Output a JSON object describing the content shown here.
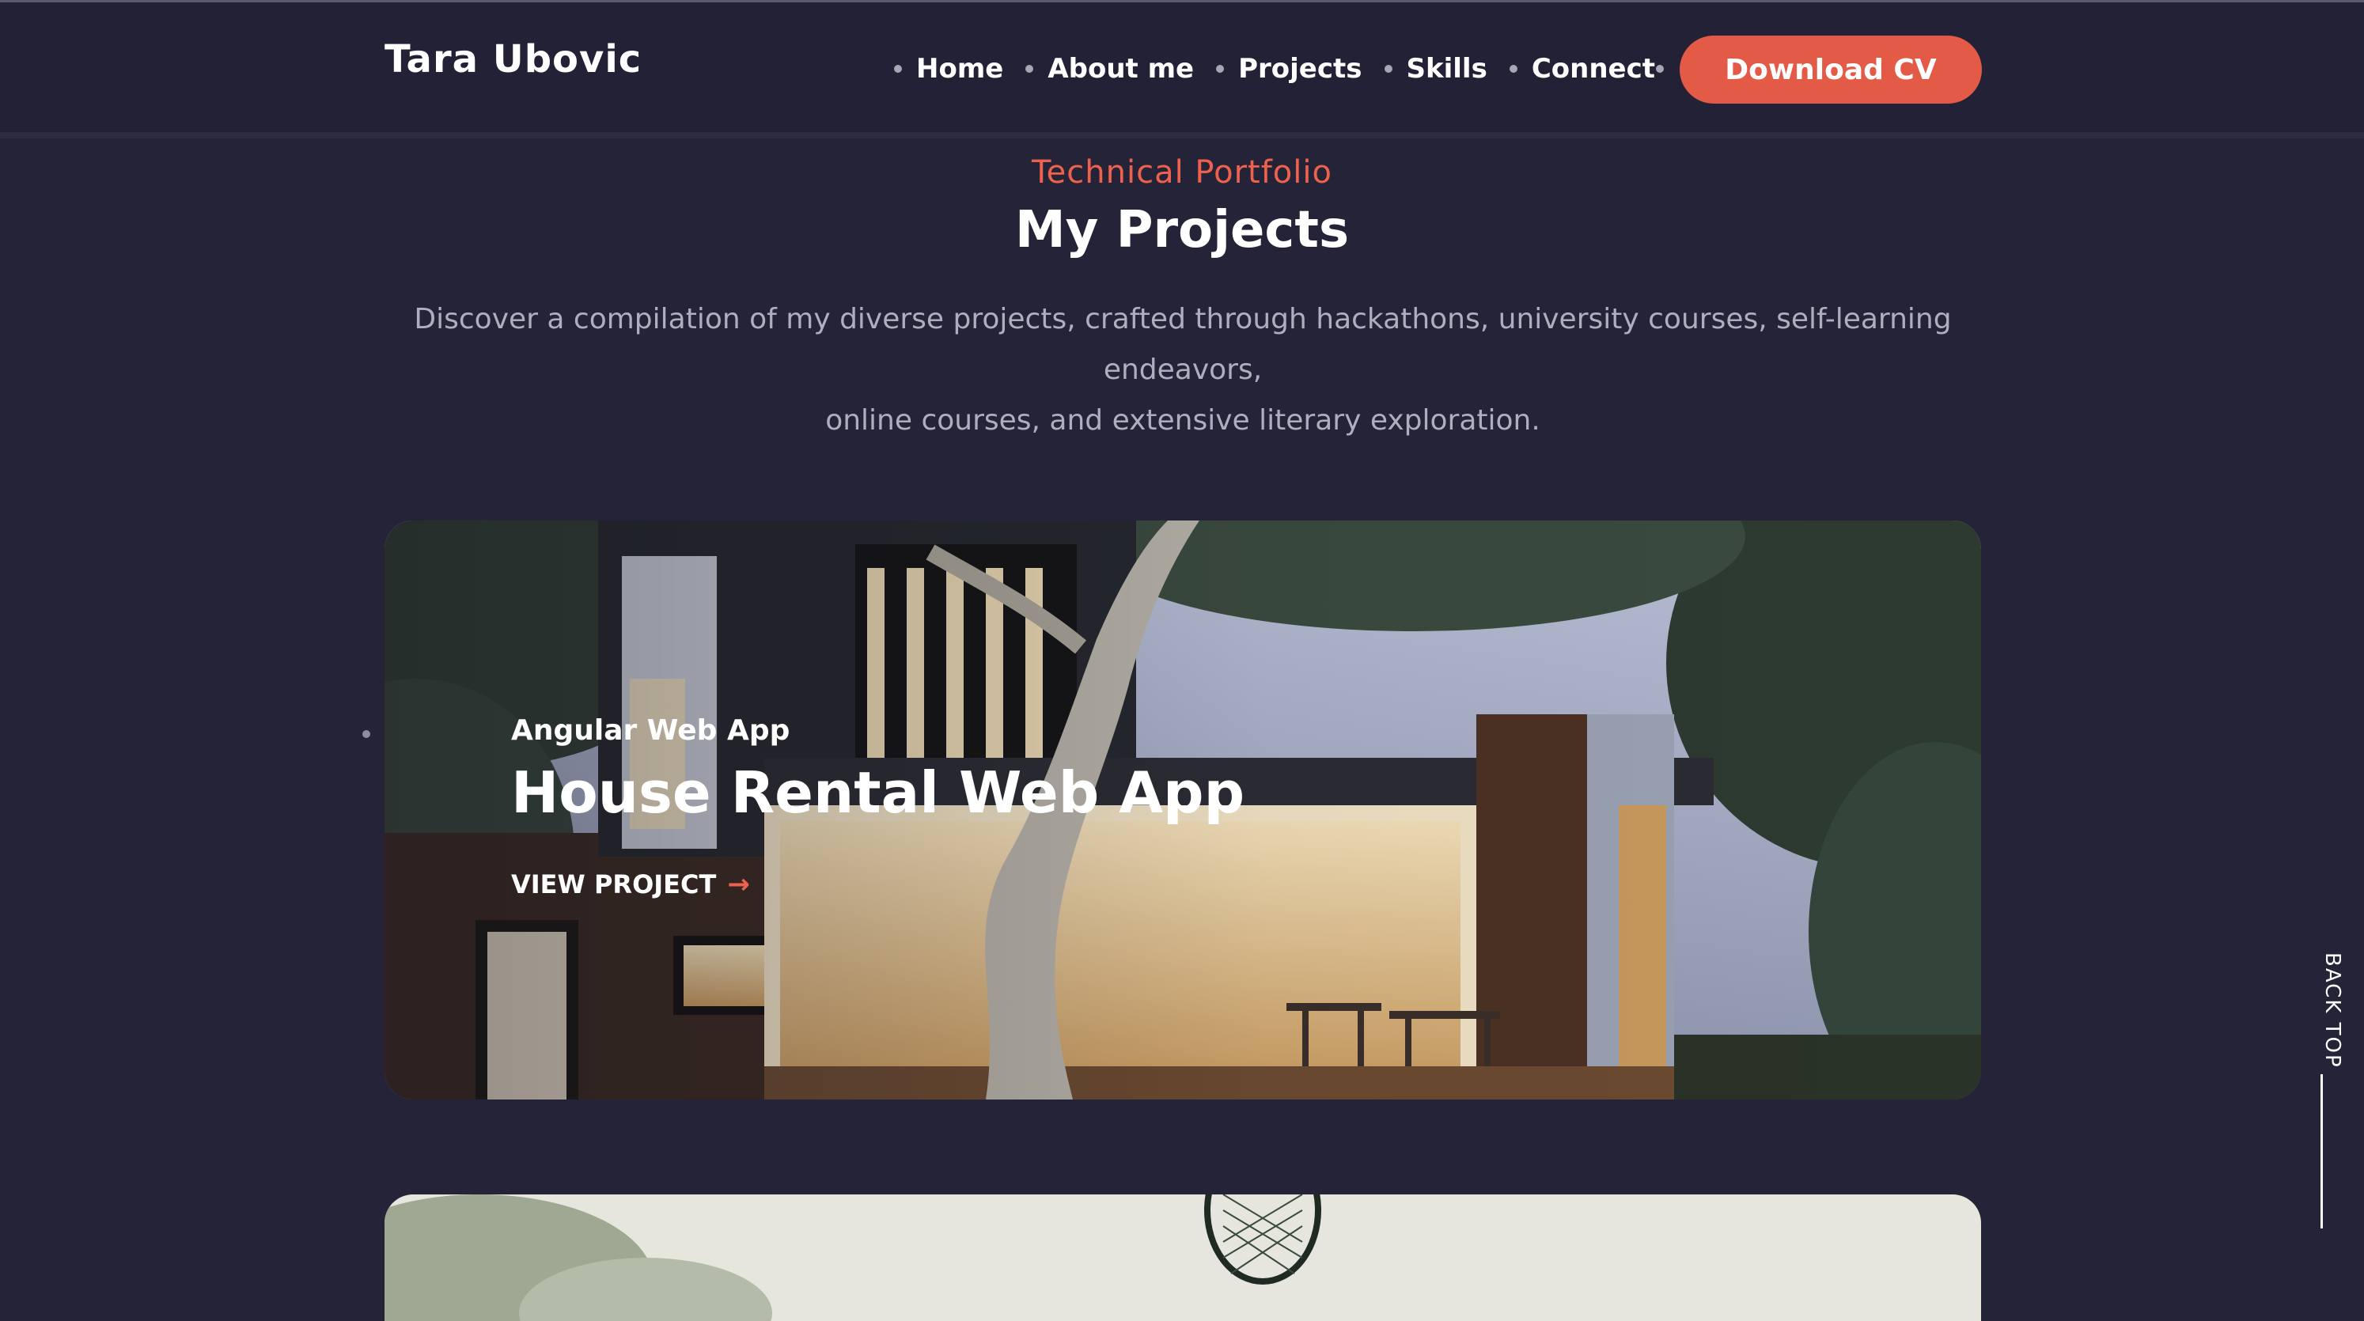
{
  "header": {
    "brand": "Tara Ubovic",
    "nav": [
      "Home",
      "About me",
      "Projects",
      "Skills",
      "Connect"
    ],
    "cta": "Download CV"
  },
  "projects_section": {
    "eyebrow": "Technical Portfolio",
    "title": "My Projects",
    "intro_line1": "Discover a compilation of my diverse projects, crafted through hackathons, university courses, self-learning endeavors,",
    "intro_line2": "online courses, and extensive literary exploration.",
    "cards": [
      {
        "subtitle": "Angular Web App",
        "title": "House Rental Web App",
        "link": "VIEW PROJECT",
        "link_icon": "arrow-right-icon",
        "image": "modern-house-photo"
      },
      {
        "image": "tennis-racket-photo"
      }
    ]
  },
  "back_to_top": "BACK TOP",
  "colors": {
    "background": "#242337",
    "accent": "#e35b47",
    "muted_text": "#aeaebf"
  }
}
